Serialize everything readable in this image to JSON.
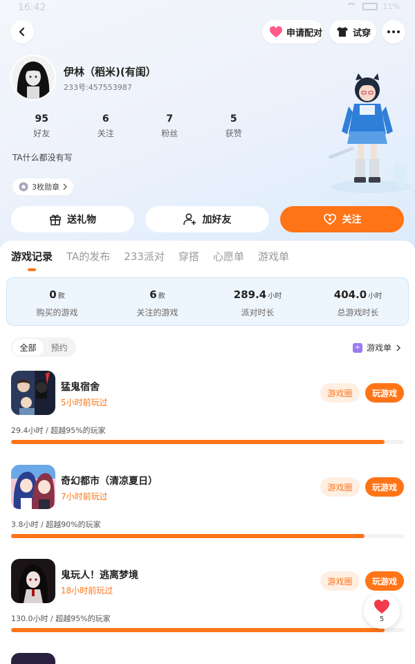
{
  "status_bar": {
    "time": "16:42",
    "battery": "11%"
  },
  "header": {
    "match_label": "申请配对",
    "try_label": "试穿"
  },
  "profile": {
    "name": "伊林（稻米)(有闺）",
    "id_text": "233号:457553987",
    "stats": [
      {
        "value": "95",
        "label": "好友"
      },
      {
        "value": "6",
        "label": "关注"
      },
      {
        "value": "7",
        "label": "粉丝"
      },
      {
        "value": "5",
        "label": "获赞"
      }
    ],
    "bio": "TA什么都没有写",
    "badges": "3枚勋章"
  },
  "actions": {
    "gift": "送礼物",
    "add_friend": "加好友",
    "follow": "关注"
  },
  "tabs": [
    "游戏记录",
    "TA的发布",
    "233派对",
    "穿搭",
    "心愿单",
    "游戏单"
  ],
  "summary": [
    {
      "value": "0",
      "unit": "款",
      "label": "购买的游戏"
    },
    {
      "value": "6",
      "unit": "款",
      "label": "关注的游戏"
    },
    {
      "value": "289.4",
      "unit": "小时",
      "label": "派对时长"
    },
    {
      "value": "404.0",
      "unit": "小时",
      "label": "总游戏时长"
    }
  ],
  "filter": {
    "all": "全部",
    "reserve": "预约"
  },
  "gamelist_link": "游戏单",
  "games": [
    {
      "name": "猛鬼宿舍",
      "last_played": "5小时前玩过",
      "stat": "29.4小时 / 超越95%的玩家",
      "percentile": 95,
      "circle": "游戏圈",
      "play": "玩游戏"
    },
    {
      "name": "奇幻都市（清凉夏日）",
      "last_played": "7小时前玩过",
      "stat": "3.8小时 / 超越90%的玩家",
      "percentile": 90,
      "circle": "游戏圈",
      "play": "玩游戏"
    },
    {
      "name": "鬼玩人！逃离梦境",
      "last_played": "18小时前玩过",
      "stat": "130.0小时 / 超越95%的玩家",
      "percentile": 95,
      "circle": "游戏圈",
      "play": "玩游戏"
    }
  ],
  "like": {
    "count": "5"
  },
  "colors": {
    "accent": "#ff7417",
    "summary_bg": "#eef6fd"
  }
}
